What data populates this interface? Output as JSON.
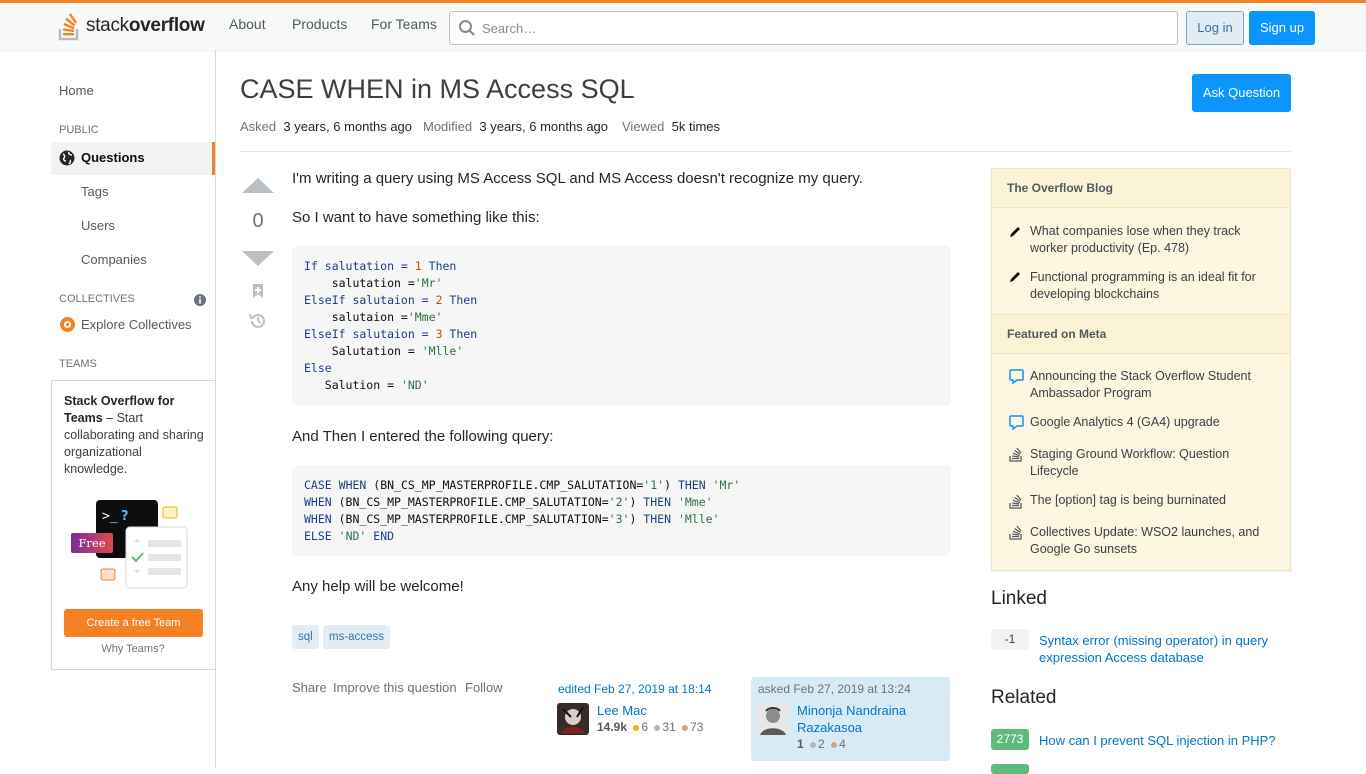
{
  "header": {
    "logo_text_plain": "stack",
    "logo_text_bold": "overflow",
    "nav": [
      "About",
      "Products",
      "For Teams"
    ],
    "search_placeholder": "Search…",
    "login": "Log in",
    "signup": "Sign up",
    "accent": "#f48225"
  },
  "left_sidebar": {
    "home": "Home",
    "public_label": "PUBLIC",
    "questions": "Questions",
    "tags": "Tags",
    "users": "Users",
    "companies": "Companies",
    "collectives_label": "COLLECTIVES",
    "explore_collectives": "Explore Collectives",
    "teams_label": "TEAMS",
    "teams_promo_bold": "Stack Overflow for Teams",
    "teams_promo_rest": " – Start collaborating and sharing organizational knowledge.",
    "free_badge": "Free",
    "create_team": "Create a free Team",
    "why_teams": "Why Teams?"
  },
  "question": {
    "title": "CASE WHEN in MS Access SQL",
    "asked_label": "Asked",
    "asked_value": "3 years, 6 months ago",
    "modified_label": "Modified",
    "modified_value": "3 years, 6 months ago",
    "viewed_label": "Viewed",
    "viewed_value": "5k times",
    "ask_button": "Ask Question",
    "votes": "0",
    "p1": "I'm writing a query using MS Access SQL and MS Access doesn't recognize my query.",
    "p2": "So I want to have something like this:",
    "p3": "And Then I entered the following query:",
    "p4": "Any help will be welcome!",
    "code1": [
      [
        "If salutation = ",
        "1",
        " Then"
      ],
      [
        "    salutation =",
        "'Mr'",
        ""
      ],
      [
        "ElseIf salutaion = ",
        "2",
        " Then"
      ],
      [
        "    salutaion =",
        "'Mme'",
        ""
      ],
      [
        "ElseIf salutaion = ",
        "3",
        " Then"
      ],
      [
        "    Salutation = ",
        "'Mlle'",
        ""
      ],
      [
        "Else",
        "",
        ""
      ],
      [
        "   Salution = ",
        "'ND'",
        ""
      ]
    ],
    "code2": [
      "CASE WHEN (BN_CS_MP_MASTERPROFILE.CMP_SALUTATION='1') THEN 'Mr'",
      "WHEN (BN_CS_MP_MASTERPROFILE.CMP_SALUTATION='2') THEN 'Mme'",
      "WHEN (BN_CS_MP_MASTERPROFILE.CMP_SALUTATION='3') THEN 'Mlle'",
      "ELSE 'ND' END"
    ],
    "tags": [
      "sql",
      "ms-access"
    ],
    "actions": [
      "Share",
      "Improve this question",
      "Follow"
    ],
    "editor": {
      "label": "edited Feb 27, 2019 at 18:14",
      "name": "Lee Mac",
      "rep": "14.9k",
      "gold": "6",
      "silver": "31",
      "bronze": "73"
    },
    "owner": {
      "label": "asked Feb 27, 2019 at 13:24",
      "name": "Minonja Nandraina Razakasoa",
      "rep": "1",
      "silver": "2",
      "bronze": "4"
    }
  },
  "right_sidebar": {
    "blog_header": "The Overflow Blog",
    "blog_items": [
      "What companies lose when they track worker productivity (Ep. 478)",
      "Functional programming is an ideal fit for developing blockchains"
    ],
    "meta_header": "Featured on Meta",
    "meta_items": [
      "Announcing the Stack Overflow Student Ambassador Program",
      "Google Analytics 4 (GA4) upgrade",
      "Staging Ground Workflow: Question Lifecycle",
      "The [option] tag is being burninated",
      "Collectives Update: WSO2 launches, and Google Go sunsets"
    ],
    "linked_title": "Linked",
    "linked": [
      {
        "score": "-1",
        "title": "Syntax error (missing operator) in query expression Access database"
      }
    ],
    "related_title": "Related",
    "related": [
      {
        "score": "2773",
        "title": "How can I prevent SQL injection in PHP?"
      }
    ]
  }
}
